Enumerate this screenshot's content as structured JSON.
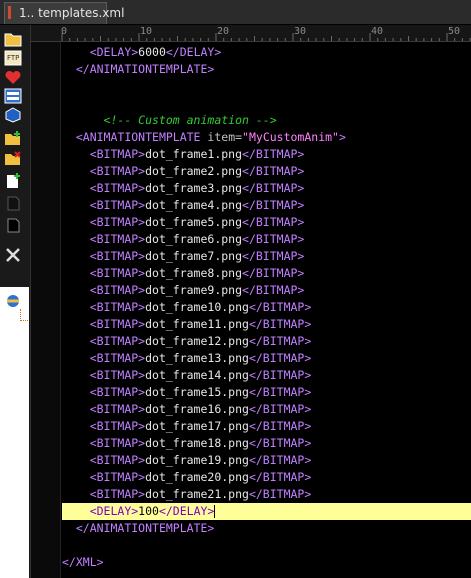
{
  "tab": {
    "label": "1.. templates.xml"
  },
  "sidebar": {
    "icons": [
      "folder-icon",
      "ftp-icon",
      "favorites-heart-icon",
      "clip-library-icon",
      "cube-icon",
      "new-folder-icon",
      "delete-folder-icon",
      "new-file-icon",
      "black-file-icon",
      "dark-file-icon",
      "tools-icon",
      "tree-root-icon"
    ]
  },
  "ruler": {
    "labels": [
      "0",
      "10",
      "20",
      "30",
      "40",
      "50"
    ]
  },
  "code": {
    "l01": {
      "indent": "    ",
      "t1": "<DELAY>",
      "v": "6000",
      "t2": "</DELAY>"
    },
    "l02": {
      "indent": "  ",
      "t1": "</ANIMATIONTEMPLATE>"
    },
    "l05": {
      "indent": "      ",
      "c": "<!-- Custom animation -->"
    },
    "l06": {
      "indent": "  ",
      "t1": "<ANIMATIONTEMPLATE ",
      "a": "item=",
      "s": "\"MyCustomAnim\"",
      "t2": ">"
    },
    "frames": [
      "dot_frame1.png",
      "dot_frame2.png",
      "dot_frame3.png",
      "dot_frame4.png",
      "dot_frame5.png",
      "dot_frame6.png",
      "dot_frame7.png",
      "dot_frame8.png",
      "dot_frame9.png",
      "dot_frame10.png",
      "dot_frame11.png",
      "dot_frame12.png",
      "dot_frame13.png",
      "dot_frame14.png",
      "dot_frame15.png",
      "dot_frame16.png",
      "dot_frame17.png",
      "dot_frame18.png",
      "dot_frame19.png",
      "dot_frame20.png",
      "dot_frame21.png"
    ],
    "bitmap_open": "<BITMAP>",
    "bitmap_close": "</BITMAP>",
    "frame_indent": "    ",
    "delay_line": {
      "indent": "    ",
      "t1": "<DELAY>",
      "v": "100",
      "t2": "</DELAY>"
    },
    "close_line": {
      "indent": "  ",
      "t1": "</ANIMATIONTEMPLATE>"
    },
    "xml_close": {
      "indent": "",
      "t1": "</XML>"
    }
  }
}
